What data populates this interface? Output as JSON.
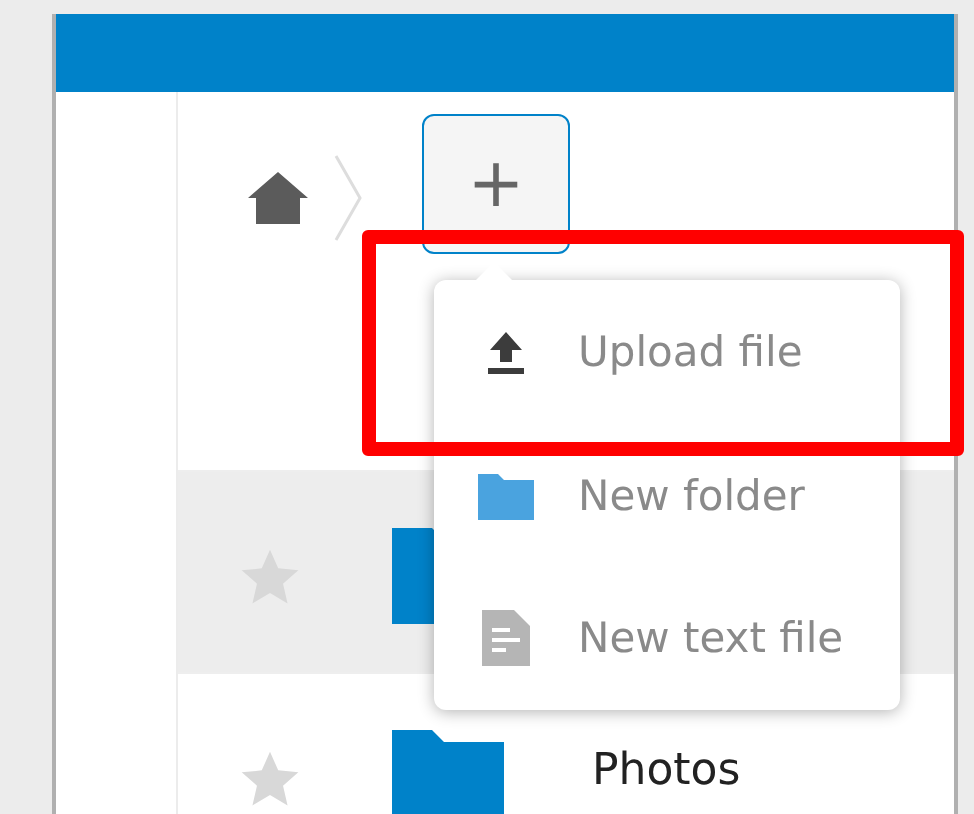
{
  "breadcrumb": {
    "new_button": "+"
  },
  "new_menu": {
    "open": true,
    "items": [
      {
        "kind": "upload",
        "label": "Upload file",
        "highlighted": true
      },
      {
        "kind": "folder",
        "label": "New folder",
        "highlighted": false
      },
      {
        "kind": "text",
        "label": "New text file",
        "highlighted": false
      }
    ]
  },
  "files": [
    {
      "starred": false,
      "hovered": true
    },
    {
      "name": "Photos",
      "starred": false,
      "hovered": false
    }
  ]
}
